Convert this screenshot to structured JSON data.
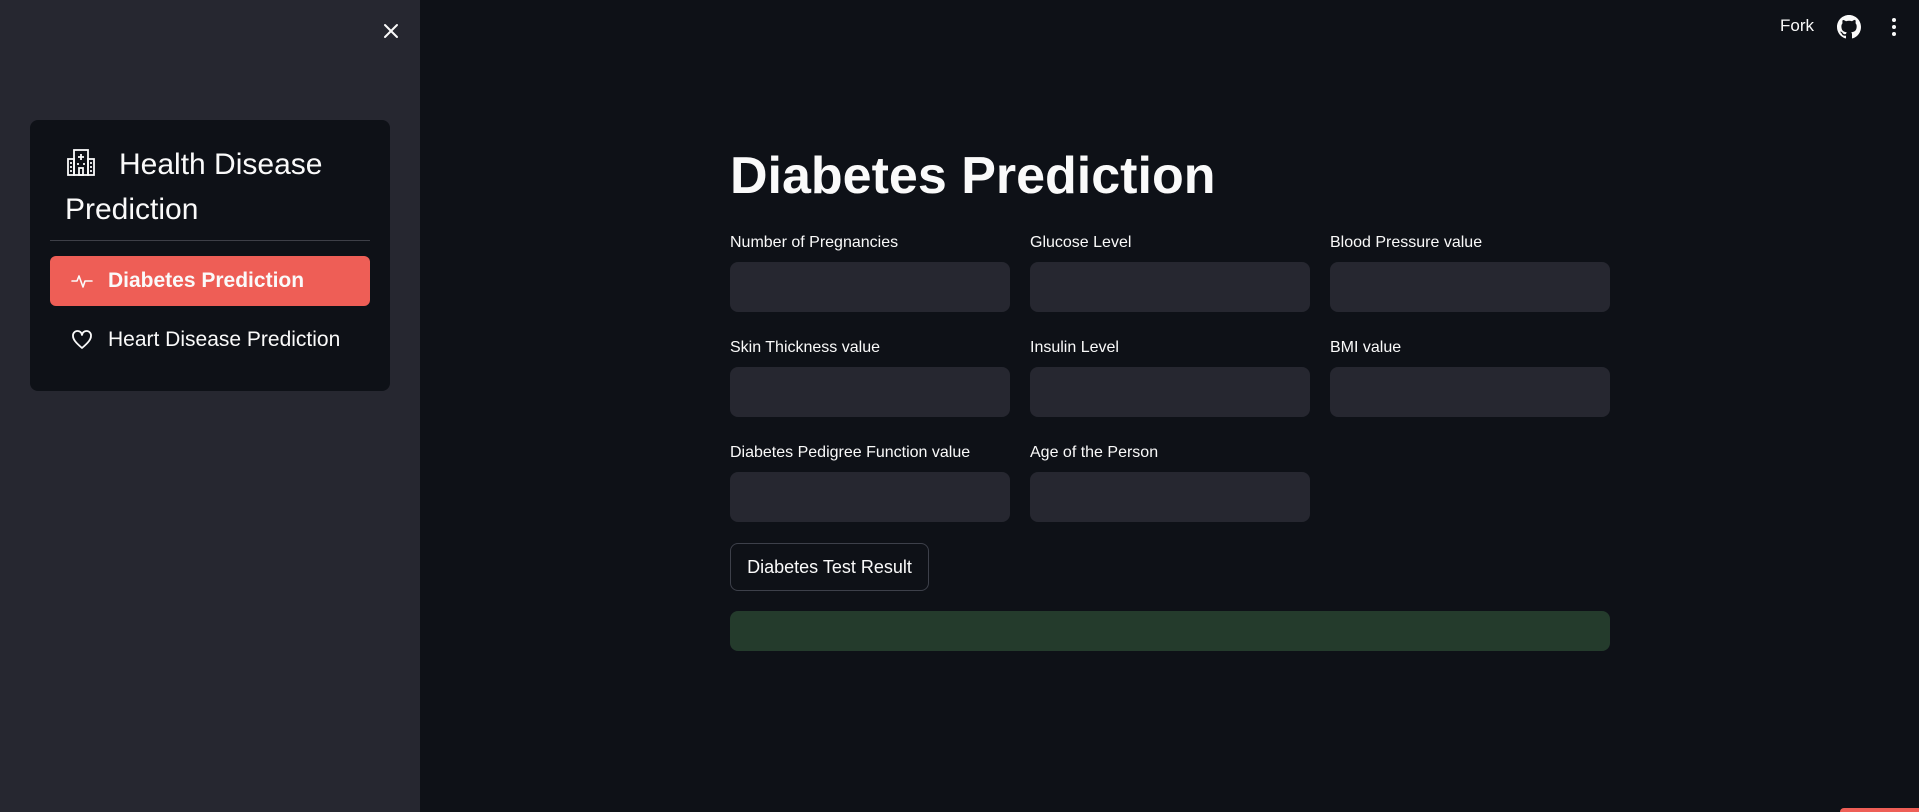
{
  "sidebar": {
    "menu_title": "Health Disease Prediction",
    "items": [
      {
        "label": "Diabetes Prediction",
        "icon": "activity-icon",
        "active": true
      },
      {
        "label": "Heart Disease Prediction",
        "icon": "heart-icon",
        "active": false
      }
    ]
  },
  "toolbar": {
    "fork_label": "Fork"
  },
  "main": {
    "title": "Diabetes Prediction",
    "fields": [
      {
        "label": "Number of Pregnancies",
        "value": ""
      },
      {
        "label": "Glucose Level",
        "value": ""
      },
      {
        "label": "Blood Pressure value",
        "value": ""
      },
      {
        "label": "Skin Thickness value",
        "value": ""
      },
      {
        "label": "Insulin Level",
        "value": ""
      },
      {
        "label": "BMI value",
        "value": ""
      },
      {
        "label": "Diabetes Pedigree Function value",
        "value": ""
      },
      {
        "label": "Age of the Person",
        "value": ""
      }
    ],
    "result_button_label": "Diabetes Test Result",
    "result_text": ""
  },
  "colors": {
    "accent": "#ee5e56",
    "sidebar_bg": "#262730",
    "main_bg": "#0e1117",
    "success_bg": "#243b2c"
  }
}
